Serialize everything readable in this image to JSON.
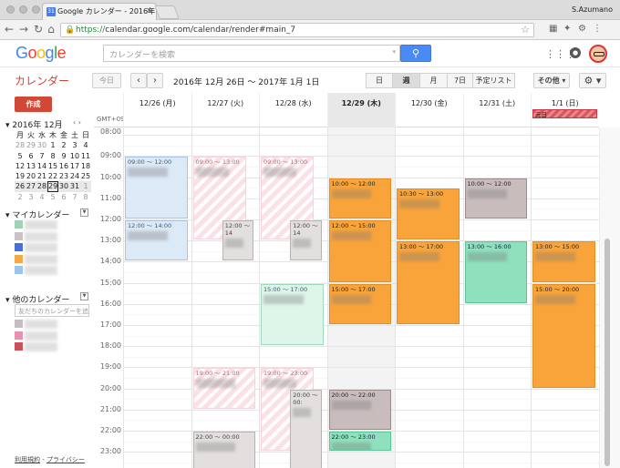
{
  "browser": {
    "tab_title": "Google カレンダー - 2016年 1",
    "tab_favicon": "31",
    "url_scheme": "https://",
    "url_rest": "calendar.google.com/calendar/render#main_7",
    "user": "S.Azumano"
  },
  "header": {
    "logo": [
      "G",
      "o",
      "o",
      "g",
      "l",
      "e"
    ],
    "search_placeholder": "カレンダーを検索"
  },
  "toolbar": {
    "app_title": "カレンダー",
    "today": "今日",
    "prev": "‹",
    "next": "›",
    "range": "2016年 12月 26日 ～ 2017年 1月 1日",
    "views": [
      "日",
      "週",
      "月",
      "7日",
      "予定リスト"
    ],
    "selected_view": "週",
    "more": "その他 ▾",
    "settings": "⚙ ▾"
  },
  "sidebar": {
    "create": "作成",
    "mini_title": "▾ 2016年 12月",
    "mini_nav": "‹   ›",
    "weekdays": [
      "月",
      "火",
      "水",
      "木",
      "金",
      "土",
      "日"
    ],
    "weeks": [
      [
        "28",
        "29",
        "30",
        "1",
        "2",
        "3",
        "4"
      ],
      [
        "5",
        "6",
        "7",
        "8",
        "9",
        "10",
        "11"
      ],
      [
        "12",
        "13",
        "14",
        "15",
        "16",
        "17",
        "18"
      ],
      [
        "19",
        "20",
        "21",
        "22",
        "23",
        "24",
        "25"
      ],
      [
        "26",
        "27",
        "28",
        "29",
        "30",
        "31",
        "1"
      ],
      [
        "2",
        "3",
        "4",
        "5",
        "6",
        "7",
        "8"
      ]
    ],
    "my_calendars_title": "▾ マイカレンダー",
    "my_calendar_colors": [
      "#9fd3b8",
      "#c9c3c3",
      "#4a6fd4",
      "#f5a84a",
      "#9ec4ec"
    ],
    "other_calendars_title": "▾ 他のカレンダー",
    "add_friend_placeholder": "友だちのカレンダーを追加",
    "other_calendar_colors": [
      "#c4bebe",
      "#e891ae",
      "#c9515a"
    ],
    "footer_terms": "利用規約",
    "footer_sep": " - ",
    "footer_privacy": "プライバシー"
  },
  "week": {
    "gmt": "GMT+09",
    "days": [
      "12/26 (月)",
      "12/27 (火)",
      "12/28 (水)",
      "12/29 (木)",
      "12/30 (金)",
      "12/31 (土)",
      "1/1 (日)"
    ],
    "today_index": 3,
    "hours": [
      "08:00",
      "09:00",
      "10:00",
      "11:00",
      "12:00",
      "13:00",
      "14:00",
      "15:00",
      "16:00",
      "17:00",
      "18:00",
      "19:00",
      "20:00",
      "21:00",
      "22:00",
      "23:00"
    ],
    "allday_event": {
      "day": 6,
      "label": "元日"
    },
    "events": [
      {
        "day": 0,
        "start": 9,
        "end": 12,
        "time": "09:00 ～ 12:00",
        "style": "blue"
      },
      {
        "day": 0,
        "start": 12,
        "end": 14,
        "time": "12:00 ～ 14:00",
        "style": "blue"
      },
      {
        "day": 1,
        "start": 9,
        "end": 13,
        "time": "09:00 ～ 13:00",
        "style": "pink",
        "narrow": true
      },
      {
        "day": 1,
        "start": 12,
        "end": 14,
        "time": "12:00 ～ 14",
        "style": "grey",
        "offset": true
      },
      {
        "day": 1,
        "start": 19,
        "end": 21,
        "time": "19:00 ～ 21:00",
        "style": "pink"
      },
      {
        "day": 1,
        "start": 22,
        "end": 24,
        "time": "22:00 ～ 00:00",
        "style": "grey"
      },
      {
        "day": 2,
        "start": 9,
        "end": 13,
        "time": "09:00 ～ 13:00",
        "style": "pink",
        "narrow": true
      },
      {
        "day": 2,
        "start": 12,
        "end": 14,
        "time": "12:00 ～ 14",
        "style": "grey",
        "offset": true
      },
      {
        "day": 2,
        "start": 15,
        "end": 18,
        "time": "15:00 ～ 17:00",
        "style": "lgreen"
      },
      {
        "day": 2,
        "start": 19,
        "end": 23,
        "time": "19:00 ～ 23:00",
        "style": "pink",
        "narrow": true
      },
      {
        "day": 2,
        "start": 20,
        "end": 24,
        "time": "20:00 ～ 00:",
        "style": "grey",
        "offset": true
      },
      {
        "day": 3,
        "start": 10,
        "end": 12,
        "time": "10:00 ～ 12:00",
        "style": "orange"
      },
      {
        "day": 3,
        "start": 12,
        "end": 15,
        "time": "12:00 ～ 15:00",
        "style": "orange"
      },
      {
        "day": 3,
        "start": 15,
        "end": 17,
        "time": "15:00 ～ 17:00",
        "style": "orange"
      },
      {
        "day": 3,
        "start": 20,
        "end": 22,
        "time": "20:00 ～ 22:00",
        "style": "dgrey"
      },
      {
        "day": 3,
        "start": 22,
        "end": 23,
        "time": "22:00 ～ 23:00",
        "style": "green"
      },
      {
        "day": 4,
        "start": 10.5,
        "end": 13,
        "time": "10:30 ～ 13:00",
        "style": "orange"
      },
      {
        "day": 4,
        "start": 13,
        "end": 17,
        "time": "13:00 ～ 17:00",
        "style": "orange"
      },
      {
        "day": 5,
        "start": 10,
        "end": 12,
        "time": "10:00 ～ 12:00",
        "style": "dgrey"
      },
      {
        "day": 5,
        "start": 13,
        "end": 16,
        "time": "13:00 ～ 16:00",
        "style": "green"
      },
      {
        "day": 6,
        "start": 13,
        "end": 15,
        "time": "13:00 ～ 15:00",
        "style": "orange"
      },
      {
        "day": 6,
        "start": 15,
        "end": 20,
        "time": "15:00 ～ 20:00",
        "style": "orange"
      }
    ]
  }
}
